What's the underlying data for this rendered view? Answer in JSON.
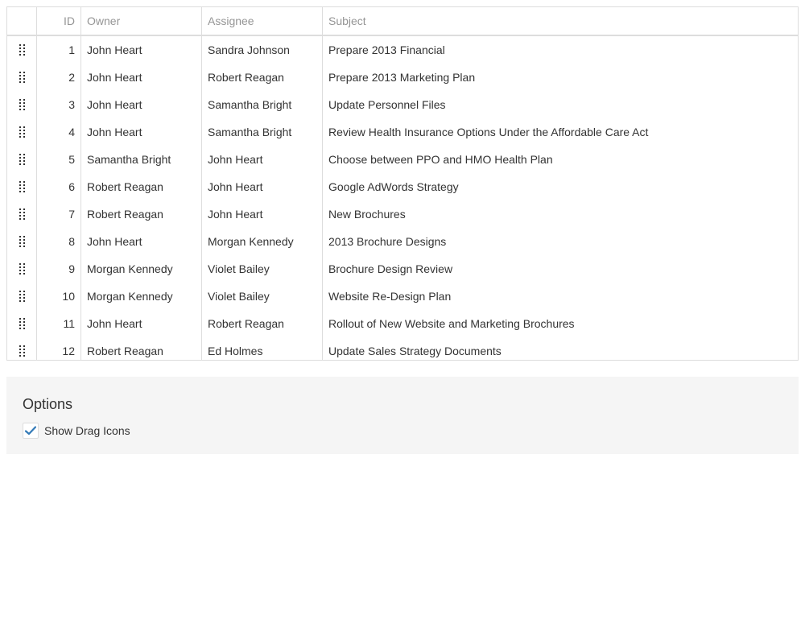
{
  "grid": {
    "columns": {
      "drag": "",
      "id": "ID",
      "owner": "Owner",
      "assignee": "Assignee",
      "subject": "Subject"
    },
    "rows": [
      {
        "id": "1",
        "owner": "John Heart",
        "assignee": "Sandra Johnson",
        "subject": "Prepare 2013 Financial"
      },
      {
        "id": "2",
        "owner": "John Heart",
        "assignee": "Robert Reagan",
        "subject": "Prepare 2013 Marketing Plan"
      },
      {
        "id": "3",
        "owner": "John Heart",
        "assignee": "Samantha Bright",
        "subject": "Update Personnel Files"
      },
      {
        "id": "4",
        "owner": "John Heart",
        "assignee": "Samantha Bright",
        "subject": "Review Health Insurance Options Under the Affordable Care Act"
      },
      {
        "id": "5",
        "owner": "Samantha Bright",
        "assignee": "John Heart",
        "subject": "Choose between PPO and HMO Health Plan"
      },
      {
        "id": "6",
        "owner": "Robert Reagan",
        "assignee": "John Heart",
        "subject": "Google AdWords Strategy"
      },
      {
        "id": "7",
        "owner": "Robert Reagan",
        "assignee": "John Heart",
        "subject": "New Brochures"
      },
      {
        "id": "8",
        "owner": "John Heart",
        "assignee": "Morgan Kennedy",
        "subject": "2013 Brochure Designs"
      },
      {
        "id": "9",
        "owner": "Morgan Kennedy",
        "assignee": "Violet Bailey",
        "subject": "Brochure Design Review"
      },
      {
        "id": "10",
        "owner": "Morgan Kennedy",
        "assignee": "Violet Bailey",
        "subject": "Website Re-Design Plan"
      },
      {
        "id": "11",
        "owner": "John Heart",
        "assignee": "Robert Reagan",
        "subject": "Rollout of New Website and Marketing Brochures"
      },
      {
        "id": "12",
        "owner": "Robert Reagan",
        "assignee": "Ed Holmes",
        "subject": "Update Sales Strategy Documents"
      }
    ]
  },
  "options": {
    "title": "Options",
    "show_drag_icons": {
      "label": "Show Drag Icons",
      "checked": true
    }
  },
  "colors": {
    "accent": "#337ab7",
    "border": "#dddddd",
    "header_text": "#959595",
    "panel_bg": "#f5f5f5"
  },
  "icons": {
    "drag_handle": "drag-handle-icon",
    "checkmark": "checkmark-icon"
  }
}
